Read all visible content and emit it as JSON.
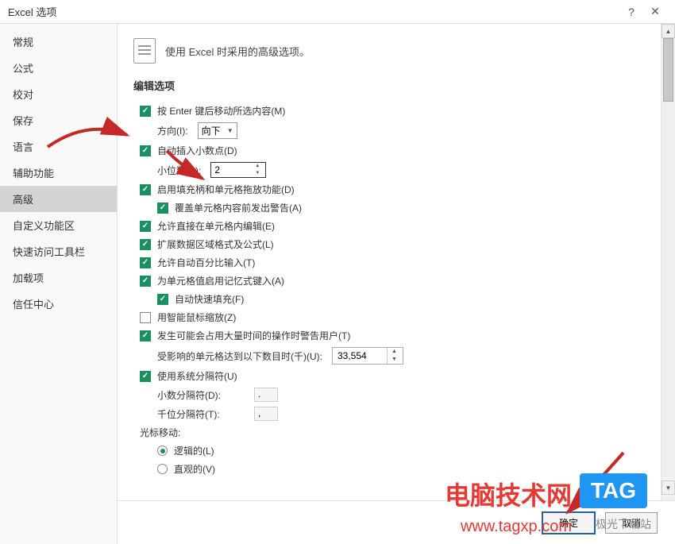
{
  "titlebar": {
    "title": "Excel 选项"
  },
  "sidebar": {
    "items": [
      {
        "label": "常规"
      },
      {
        "label": "公式"
      },
      {
        "label": "校对"
      },
      {
        "label": "保存"
      },
      {
        "label": "语言"
      },
      {
        "label": "辅助功能"
      },
      {
        "label": "高级"
      },
      {
        "label": "自定义功能区"
      },
      {
        "label": "快速访问工具栏"
      },
      {
        "label": "加载项"
      },
      {
        "label": "信任中心"
      }
    ]
  },
  "header": {
    "text": "使用 Excel 时采用的高级选项。"
  },
  "section": {
    "title": "编辑选项"
  },
  "options": {
    "enter_move": "按 Enter 键后移动所选内容(M)",
    "direction_label": "方向(I):",
    "direction_value": "向下",
    "auto_decimal": "自动插入小数点(D)",
    "decimal_places_label": "小位数(P):",
    "decimal_places_value": "2",
    "fill_handle": "启用填充柄和单元格拖放功能(D)",
    "overwrite_warning": "覆盖单元格内容前发出警告(A)",
    "edit_in_cell": "允许直接在单元格内编辑(E)",
    "extend_range": "扩展数据区域格式及公式(L)",
    "auto_percent": "允许自动百分比输入(T)",
    "autocomplete": "为单元格值启用记忆式键入(A)",
    "flash_fill": "自动快速填充(F)",
    "intellimouse": "用智能鼠标缩放(Z)",
    "long_op_warning": "发生可能会占用大量时间的操作时警告用户(T)",
    "affected_cells_label": "受影响的单元格达到以下数目时(千)(U):",
    "affected_cells_value": "33,554",
    "system_separators": "使用系统分隔符(U)",
    "decimal_sep_label": "小数分隔符(D):",
    "decimal_sep_value": ".",
    "thousand_sep_label": "千位分隔符(T):",
    "thousand_sep_value": ",",
    "cursor_group": "光标移动:",
    "logical": "逻辑的(L)",
    "visual": "直观的(V)"
  },
  "footer": {
    "ok": "确定",
    "cancel": "取消"
  },
  "watermark": {
    "line1": "电脑技术网",
    "line2": "www.tagxp.com",
    "tag": "TAG",
    "logo": "极光下载站"
  }
}
